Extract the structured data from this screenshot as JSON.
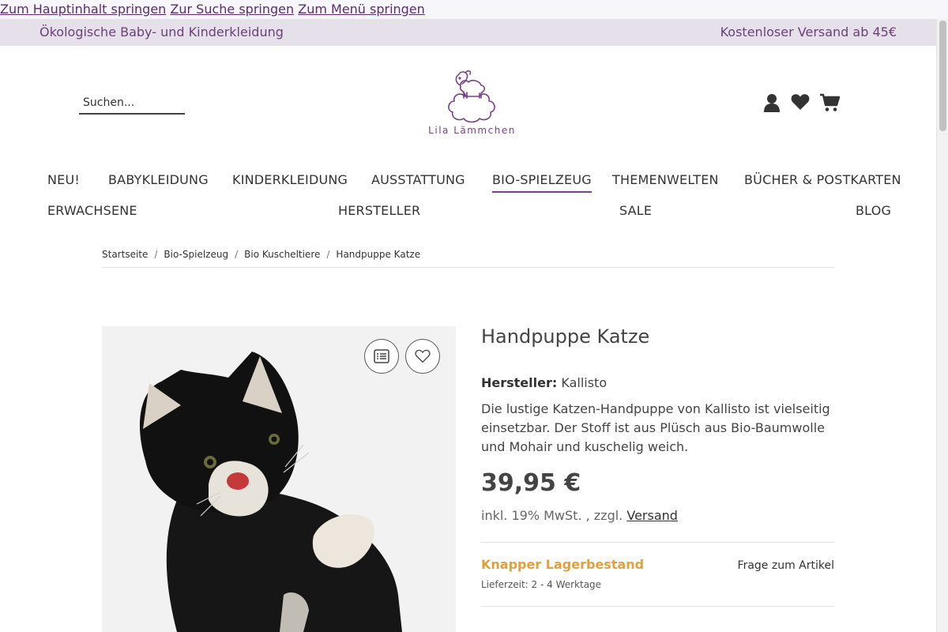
{
  "skip_links": [
    "Zum Hauptinhalt springen",
    "Zur Suche springen",
    "Zum Menü springen"
  ],
  "topbar": {
    "left": "Ökologische Baby- und Kinderkleidung",
    "right": "Kostenloser Versand ab 45€"
  },
  "search": {
    "placeholder": "Suchen..."
  },
  "logo": {
    "text": "Lila Lämmchen",
    "color": "#7a3f8a"
  },
  "header_icons": [
    "user-icon",
    "heart-icon",
    "cart-icon"
  ],
  "nav": {
    "row1": [
      "NEU!",
      "BABYKLEIDUNG",
      "KINDERKLEIDUNG",
      "AUSSTATTUNG",
      "BIO-SPIELZEUG",
      "THEMENWELTEN",
      "BÜCHER & POSTKARTEN"
    ],
    "row2": [
      "ERWACHSENE",
      "HERSTELLER",
      "SALE",
      "BLOG"
    ],
    "active": "BIO-SPIELZEUG"
  },
  "breadcrumb": [
    "Startseite",
    "Bio-Spielzeug",
    "Bio Kuscheltiere",
    "Handpuppe Katze"
  ],
  "product": {
    "title": "Handpuppe Katze",
    "manufacturer_label": "Hersteller:",
    "manufacturer": "Kallisto",
    "description": "Die lustige Katzen-Handpuppe von Kallisto ist vielseitig einsetzbar. Der Stoff ist aus Plüsch aus Bio-Baumwolle und Mohair und kuschelig weich.",
    "price": "39,95 €",
    "tax_text": "inkl. 19% MwSt. , zzgl.",
    "shipping_link": "Versand",
    "stock": "Knapper Lagerbestand",
    "delivery": "Lieferzeit: 2 - 4 Werktage",
    "question": "Frage zum Artikel"
  },
  "gallery_buttons": [
    "compare-list-icon",
    "wishlist-heart-icon"
  ],
  "colors": {
    "brand": "#7a3f8a",
    "topbar_bg": "#e6e0ea",
    "stock": "#e0a13c"
  }
}
